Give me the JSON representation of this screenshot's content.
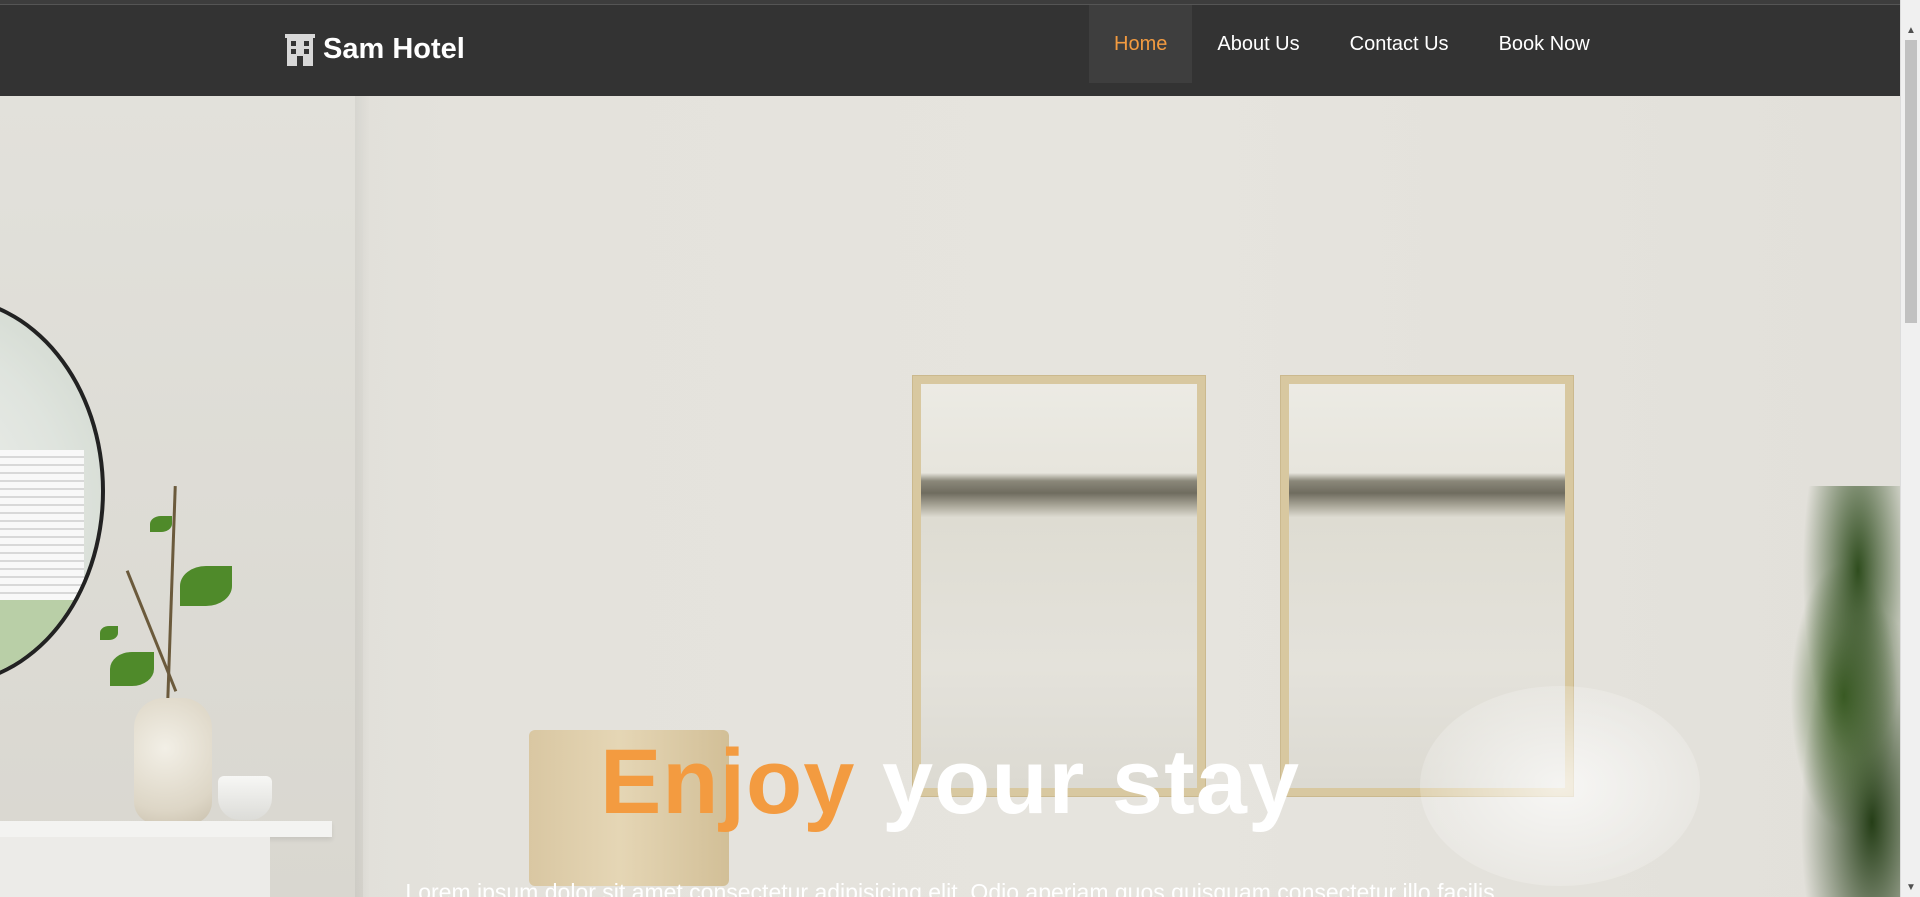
{
  "brand": {
    "name": "Sam Hotel",
    "icon": "hotel-icon"
  },
  "nav": {
    "items": [
      {
        "label": "Home",
        "active": true
      },
      {
        "label": "About Us",
        "active": false
      },
      {
        "label": "Contact Us",
        "active": false
      },
      {
        "label": "Book Now",
        "active": false
      }
    ]
  },
  "hero": {
    "title_accent": "Enjoy",
    "title_rest": "your stay",
    "text": "Lorem ipsum dolor sit amet consectetur adipisicing elit. Odio aperiam quos quisquam consectetur illo facilis"
  },
  "colors": {
    "accent": "#f39b40",
    "navbar": "#333333",
    "text": "#ffffff"
  }
}
